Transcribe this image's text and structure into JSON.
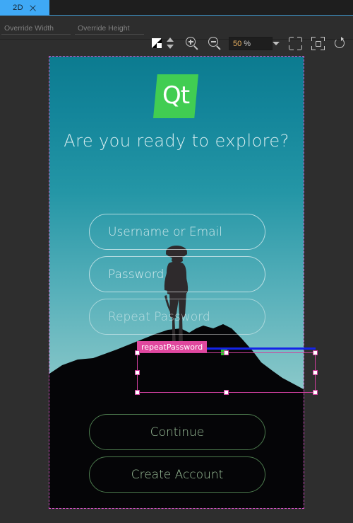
{
  "window": {
    "background_color": "#2e2e2e"
  },
  "tabbar": {
    "active_tab": "2D",
    "close_icon": "close-icon",
    "accent_color": "#3fa9f5"
  },
  "toolbar": {
    "override_width_placeholder": "Override Width",
    "override_width_value": "",
    "override_height_placeholder": "Override Height",
    "override_height_value": "",
    "zoom_value": "50",
    "zoom_unit": "%",
    "icons": [
      "checkerboard-icon",
      "up-down-arrows-icon",
      "zoom-in-icon",
      "zoom-out-icon",
      "chevron-down-icon",
      "fit-to-view-icon",
      "select-outer-icon",
      "reload-icon"
    ]
  },
  "canvas": {
    "frame_border_color": "#d14ec0",
    "background_top_color": "#0c7b90",
    "background_bottom_color": "#b2d6d4",
    "logo": {
      "text": "Qt",
      "shape_color": "#41cd52",
      "text_color": "#ffffff"
    },
    "headline": "Are you ready to explore?",
    "fields": [
      {
        "name": "username",
        "placeholder": "Username or Email"
      },
      {
        "name": "password",
        "placeholder": "Password"
      },
      {
        "name": "repeatPassword",
        "placeholder": "Repeat Password"
      }
    ],
    "buttons": [
      {
        "name": "continue",
        "label": "Continue"
      },
      {
        "name": "createAccount",
        "label": "Create Account"
      }
    ],
    "button_border_color": "#4c7a4d",
    "button_text_color": "#9ec39c"
  },
  "selection": {
    "label": "repeatPassword",
    "label_bg_color": "#e0489e",
    "border_color": "#cf3f9d",
    "anchor_line_color": "#1423e8",
    "anchor_dot_color": "#2fbf2a"
  }
}
